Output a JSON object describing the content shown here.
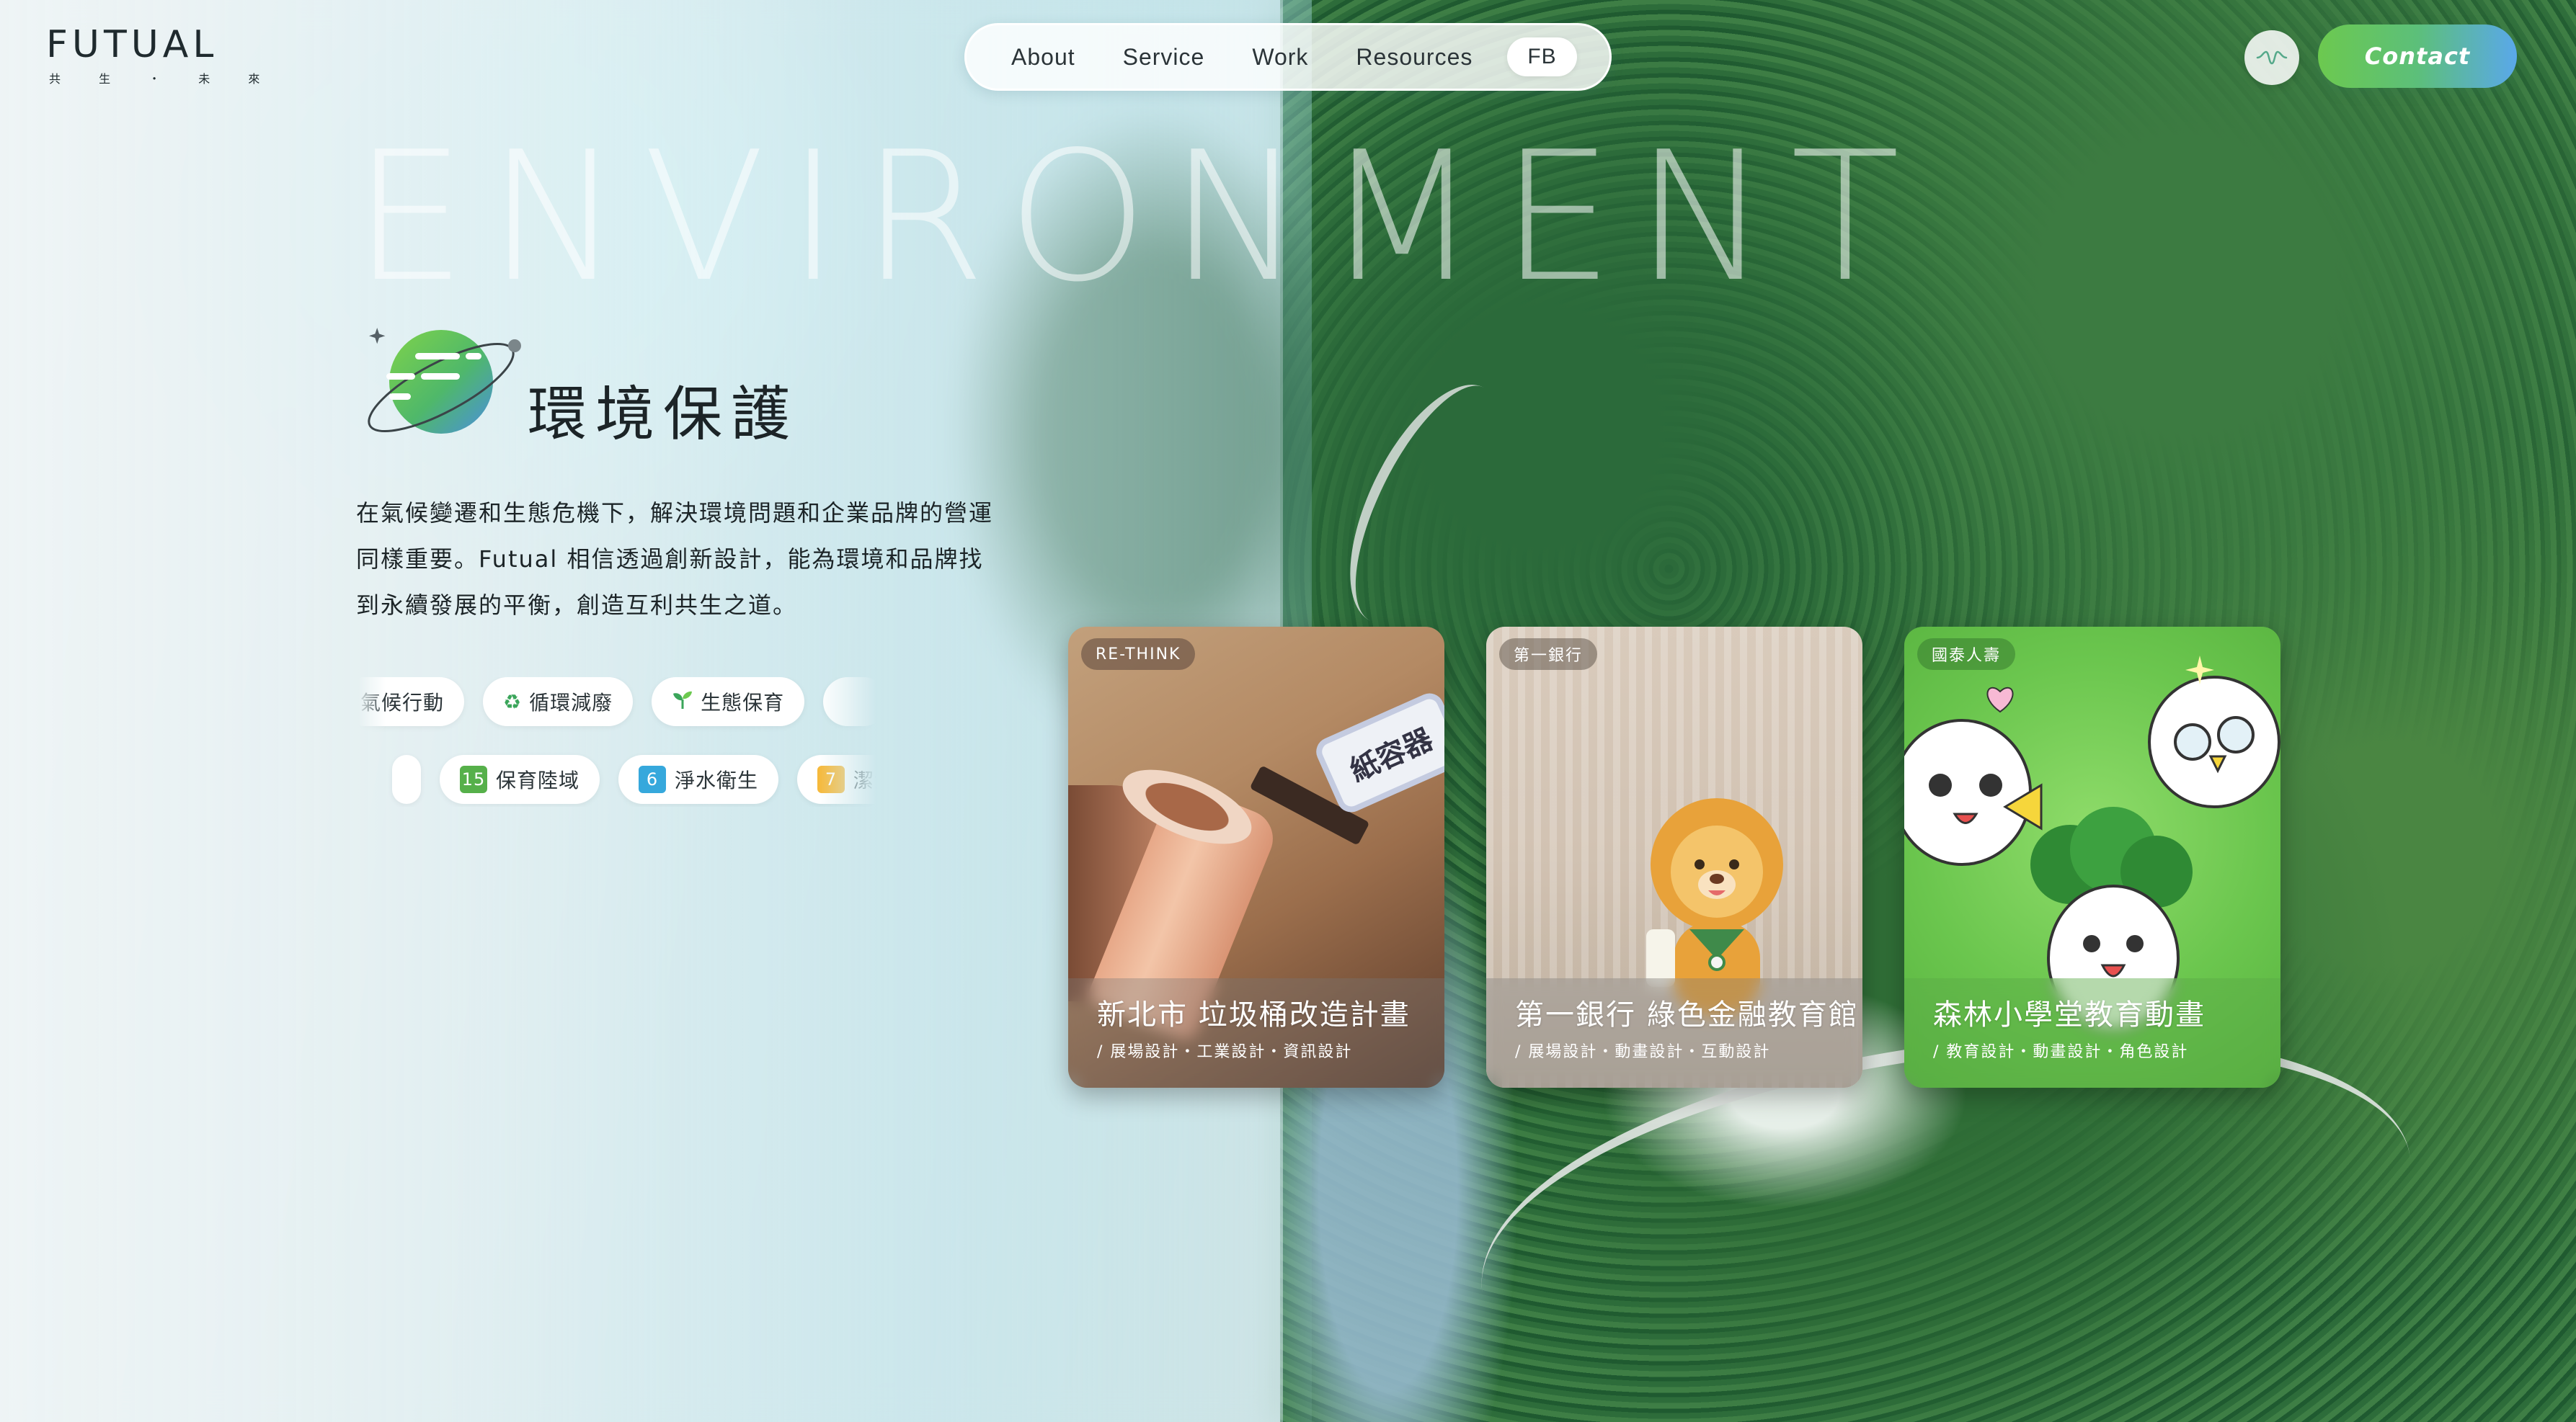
{
  "header": {
    "logo": {
      "word": "FUTUAL",
      "subtitle": "共 生 ・ 未 來"
    },
    "nav": [
      {
        "label": "About"
      },
      {
        "label": "Service"
      },
      {
        "label": "Work"
      },
      {
        "label": "Resources"
      }
    ],
    "nav_fb": "FB",
    "pulse_icon": "waveform-icon",
    "contact_label": "Contact"
  },
  "hero": {
    "big_word": "ENVIRONMENT",
    "title": "環境保護",
    "title_icon": "planet-icon",
    "description_lines": [
      "在氣候變遷和生態危機下，解決環境問題和企業品牌的營運",
      "同樣重要。Futual 相信透過創新設計，能為環境和品牌找",
      "到永續發展的平衡，創造互利共生之道。"
    ]
  },
  "tags": {
    "row1": [
      {
        "label": "氣候行動",
        "icon": ""
      },
      {
        "label": "循環減廢",
        "icon": "recycle-icon"
      },
      {
        "label": "生態保育",
        "icon": "sprout-icon"
      },
      {
        "label": "",
        "icon": ""
      }
    ],
    "row2": [
      {
        "label": "",
        "num": ""
      },
      {
        "label": "保育陸域",
        "num": "15",
        "color": "#56b04a"
      },
      {
        "label": "淨水衛生",
        "num": "6",
        "color": "#36a8dc"
      },
      {
        "label": "潔淨能",
        "num": "7",
        "color": "#f6b93b"
      }
    ]
  },
  "cards": [
    {
      "badge": "RE-THINK",
      "title": "新北市 垃圾桶改造計畫",
      "subtitle": "/ 展場設計・工業設計・資訊設計",
      "label_tag": "紙容器"
    },
    {
      "badge": "第一銀行",
      "title": "第一銀行 綠色金融教育館",
      "subtitle": "/ 展場設計・動畫設計・互動設計"
    },
    {
      "badge": "國泰人壽",
      "title": "森林小學堂教育動畫",
      "subtitle": "/ 教育設計・動畫設計・角色設計"
    }
  ],
  "colors": {
    "contact_gradient_start": "#6cc94f",
    "contact_gradient_end": "#5aa8ea",
    "text_dark": "#1c2427"
  }
}
